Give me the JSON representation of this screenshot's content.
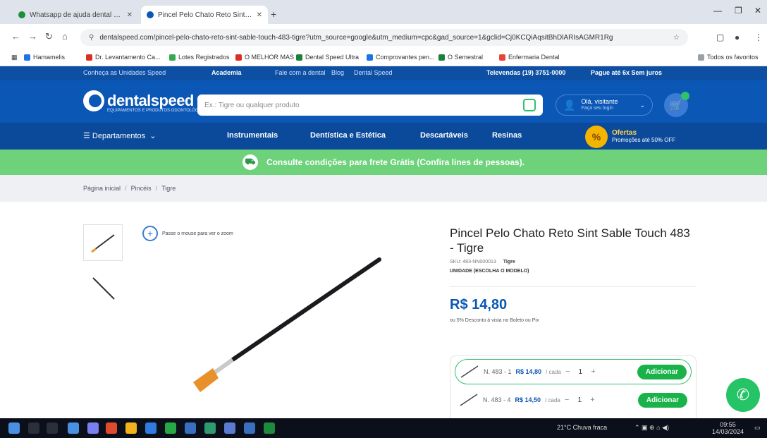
{
  "browser": {
    "tabs": [
      {
        "label": "Whatsapp de ajuda dental Ultrahigh",
        "active": false,
        "color": "#1a8f3c"
      },
      {
        "label": "Pincel Pelo Chato Reto Sint Sa...",
        "active": true,
        "color": "#0b57b6"
      }
    ],
    "new_tab": "+",
    "url": "dentalspeed.com/pincel-pelo-chato-reto-sint-sable-touch-483-tigre?utm_source=google&utm_medium=cpc&gad_source=1&gclid=Cj0KCQiAqsitBhDlARIsAGMR1Rg",
    "bookmarks": [
      {
        "label": "Hamamelis",
        "color": "#1a73e8"
      },
      {
        "label": "Dr. Levantamento Ca...",
        "color": "#d93025"
      },
      {
        "label": "Lotes Registrados",
        "color": "#34a853"
      },
      {
        "label": "O MELHOR MAS",
        "color": "#d93025"
      },
      {
        "label": "Dental Speed Ultra",
        "color": "#188038"
      },
      {
        "label": "Comprovantes pen...",
        "color": "#1a73e8"
      },
      {
        "label": "O Semestral",
        "color": "#188038"
      },
      {
        "label": "Enfermaria Dental",
        "color": "#ea4335"
      }
    ],
    "bookmarks_right": "Todos os favoritos"
  },
  "site": {
    "topstrip": [
      {
        "label": "Conheça as Unidades Speed",
        "bold": false
      },
      {
        "label": "Academia",
        "bold": true
      },
      {
        "label": "Fale com a dental",
        "bold": false
      },
      {
        "label": "Blog",
        "bold": false
      },
      {
        "label": "Dental Speed",
        "bold": false
      },
      {
        "label": "Televendas (19) 3751-0000",
        "bold": true
      },
      {
        "label": "Pague até 6x Sem juros",
        "bold": true
      }
    ],
    "logo": "dentalspeed",
    "logo_tag": "EQUIPAMENTOS E PRODUTOS ODONTOLÓGICOS",
    "search_placeholder": "Ex.: Tigre ou qualquer produto",
    "account": {
      "title": "Olá, visitante",
      "sub": "Faça seu login"
    },
    "nav": [
      "Departamentos",
      "Instrumentais",
      "Dentística e Estética",
      "Descartáveis",
      "Resinas"
    ],
    "offer": {
      "title": "Ofertas",
      "sub": "Promoções até 50% OFF",
      "icon": "%"
    },
    "promo": "Consulte condições para frete Grátis (Confira lines de pessoas).",
    "breadcrumbs": [
      "Página inicial",
      "Pincéis",
      "Tigre"
    ]
  },
  "product": {
    "zoom_hint": "Passe o mouse para ver o zoom",
    "title": "Pincel Pelo Chato Reto Sint Sable Touch 483 - Tigre",
    "sku_label": "SKU: 483-NN000013",
    "brand": "Tigre",
    "unit": "UNIDADE (ESCOLHA O MODELO)",
    "price": "R$ 14,80",
    "installments": "ou 5% Desconto à vista no Boleto ou Pix",
    "variants": [
      {
        "code": "N. 483 - 1",
        "price": "R$ 14,80",
        "each": "/ cada",
        "qty": "1",
        "action": "Adicionar"
      },
      {
        "code": "N. 483 - 4",
        "price": "R$ 14,50",
        "each": "/ cada",
        "qty": "1",
        "action": "Adicionar"
      }
    ]
  },
  "taskbar": {
    "weather": "21°C Chuva fraca",
    "time": "09:55",
    "date": "14/03/2024"
  },
  "colors": {
    "primary": "#0b57b6",
    "accent": "#2ec26b",
    "offer": "#f5b400"
  }
}
